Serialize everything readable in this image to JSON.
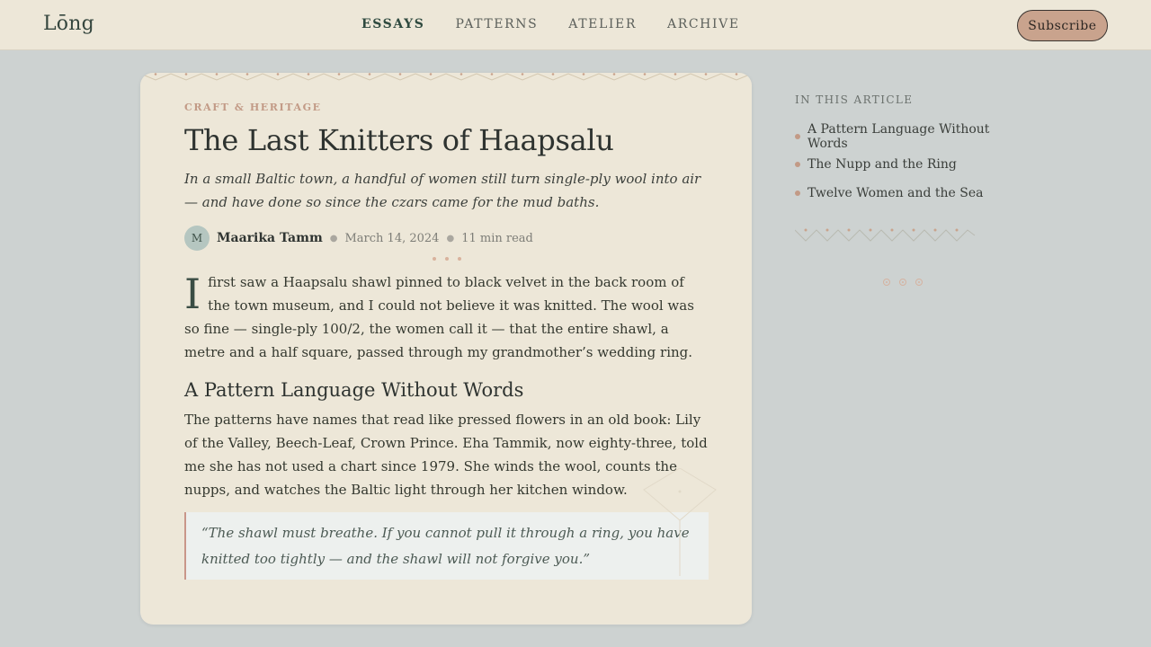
{
  "brand": {
    "logo": "Lōng"
  },
  "nav": {
    "items": [
      {
        "label": "ESSAYS",
        "active": true
      },
      {
        "label": "PATTERNS",
        "active": false
      },
      {
        "label": "ATELIER",
        "active": false
      },
      {
        "label": "ARCHIVE",
        "active": false
      }
    ],
    "subscribe_label": "Subscribe"
  },
  "article": {
    "kicker": "CRAFT & HERITAGE",
    "title": "The Last Knitters of Haapsalu",
    "dek": "In a small Baltic town, a handful of women still turn single-ply wool into air — and have done so since the czars came for the mud baths.",
    "author": {
      "initial": "M",
      "name": "Maarika Tamm"
    },
    "date": "March 14, 2024",
    "read_time": "11 min read",
    "dropcap": "I",
    "intro": "first saw a Haapsalu shawl pinned to black velvet in the back room of the town museum, and I could not believe it was knitted. The wool was so fine — single-ply 100/2, the women call it — that the entire shawl, a metre and a half square, passed through my grandmother’s wedding ring.",
    "section_heading": "A Pattern Language Without Words",
    "section_text": "The patterns have names that read like pressed flowers in an old book: Lily of the Valley, Beech-Leaf, Crown Prince. Eha Tammik, now eighty-three, told me she has not used a chart since 1979. She winds the wool, counts the nupps, and watches the Baltic light through her kitchen window.",
    "quote": "“The shawl must breathe. If you cannot pull it through a ring, you have knitted too tightly — and the shawl will not forgive you.”"
  },
  "toc": {
    "title": "IN THIS ARTICLE",
    "items": [
      {
        "label": "A Pattern Language Without Words"
      },
      {
        "label": "The Nupp and the Ring"
      },
      {
        "label": "Twelve Women and the Sea"
      }
    ]
  },
  "colors": {
    "background": "#cdd2d1",
    "paper": "#ede7d8",
    "accent": "#c29a86",
    "ink": "#2f3431",
    "subscribe_fill": "#c9a38d"
  }
}
